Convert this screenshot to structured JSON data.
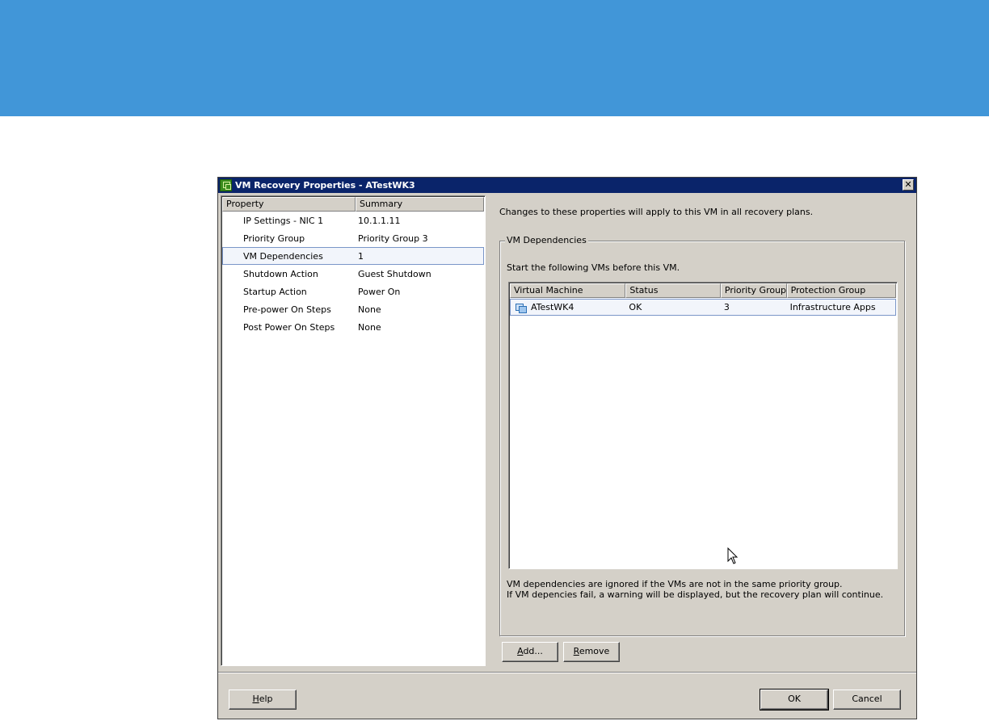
{
  "window": {
    "title": "VM Recovery Properties - ATestWK3",
    "close_label": "✕"
  },
  "property_list": {
    "columns": [
      "Property",
      "Summary"
    ],
    "rows": [
      {
        "property": "IP Settings - NIC 1",
        "summary": "10.1.1.11"
      },
      {
        "property": "Priority Group",
        "summary": "Priority Group 3"
      },
      {
        "property": "VM Dependencies",
        "summary": "1",
        "selected": true
      },
      {
        "property": "Shutdown Action",
        "summary": "Guest Shutdown"
      },
      {
        "property": "Startup Action",
        "summary": "Power On"
      },
      {
        "property": "Pre-power On Steps",
        "summary": "None"
      },
      {
        "property": "Post Power On Steps",
        "summary": "None"
      }
    ]
  },
  "details": {
    "info_text": "Changes to these properties will apply to this VM in all recovery plans.",
    "group_title": "VM Dependencies",
    "start_text": "Start the following VMs before this VM.",
    "table": {
      "columns": [
        "Virtual Machine",
        "Status",
        "Priority Group",
        "Protection Group"
      ],
      "rows": [
        {
          "vm": "ATestWK4",
          "status": "OK",
          "priority_group": "3",
          "protection_group": "Infrastructure Apps"
        }
      ]
    },
    "note_line1": "VM dependencies are ignored if the VMs are not in the same priority group.",
    "note_line2": "If VM depencies fail, a warning will be displayed, but the recovery plan will continue."
  },
  "buttons": {
    "add": {
      "mnemonic": "A",
      "rest": "dd..."
    },
    "remove": {
      "mnemonic": "R",
      "rest": "emove"
    },
    "help": {
      "mnemonic": "H",
      "rest": "elp"
    },
    "ok": "OK",
    "cancel": "Cancel"
  },
  "colors": {
    "banner": "#4196d8",
    "titlebar": "#0a246a",
    "selection_outline": "#7a96c8"
  }
}
